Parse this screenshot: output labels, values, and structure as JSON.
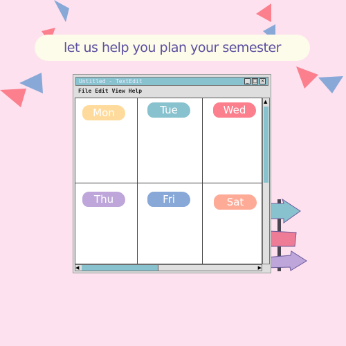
{
  "banner": {
    "text": "let us help you plan your semester"
  },
  "window": {
    "title": "Untitled - TextEdit",
    "menu": [
      "File",
      "Edit",
      "View",
      "Help"
    ]
  },
  "days": [
    {
      "label": "Mon",
      "color": "#fedb9c"
    },
    {
      "label": "Tue",
      "color": "#89c2cf"
    },
    {
      "label": "Wed",
      "color": "#fb7f8d"
    },
    {
      "label": "Thu",
      "color": "#bea6da"
    },
    {
      "label": "Fri",
      "color": "#88a8d8"
    },
    {
      "label": "Sat",
      "color": "#fdab97"
    }
  ]
}
